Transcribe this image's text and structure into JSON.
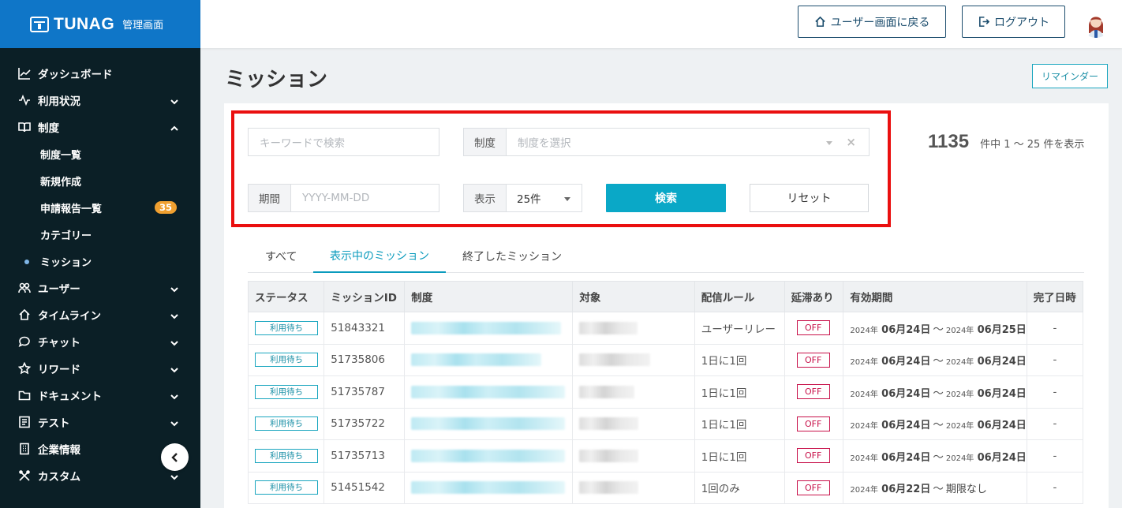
{
  "brand": {
    "name": "TUNAG",
    "subtitle": "管理画面"
  },
  "sidebar": {
    "items": [
      {
        "label": "ダッシュボード",
        "icon": "chart-line-icon"
      },
      {
        "label": "利用状況",
        "icon": "activity-icon"
      },
      {
        "label": "制度",
        "icon": "book-icon"
      },
      {
        "label": "ユーザー",
        "icon": "users-icon"
      },
      {
        "label": "タイムライン",
        "icon": "home-icon"
      },
      {
        "label": "チャット",
        "icon": "chat-icon"
      },
      {
        "label": "リワード",
        "icon": "star-icon"
      },
      {
        "label": "ドキュメント",
        "icon": "folder-icon"
      },
      {
        "label": "テスト",
        "icon": "checklist-icon"
      },
      {
        "label": "企業情報",
        "icon": "building-icon"
      },
      {
        "label": "カスタム",
        "icon": "tools-icon"
      }
    ],
    "sub_items": [
      {
        "label": "制度一覧"
      },
      {
        "label": "新規作成"
      },
      {
        "label": "申請報告一覧",
        "badge": "35"
      },
      {
        "label": "カテゴリー"
      },
      {
        "label": "ミッション"
      }
    ]
  },
  "header": {
    "back_label": "ユーザー画面に戻る",
    "logout_label": "ログアウト"
  },
  "page": {
    "title": "ミッション",
    "reminder_label": "リマインダー"
  },
  "filters": {
    "keyword_placeholder": "キーワードで検索",
    "system_label": "制度",
    "system_placeholder": "制度を選択",
    "period_label": "期間",
    "period_placeholder": "YYYY-MM-DD",
    "display_label": "表示",
    "display_value": "25件",
    "search_label": "検索",
    "reset_label": "リセット"
  },
  "results": {
    "total": "1135",
    "text": "件中 1 〜 25 件を表示"
  },
  "tabs": [
    {
      "label": "すべて"
    },
    {
      "label": "表示中のミッション"
    },
    {
      "label": "終了したミッション"
    }
  ],
  "table": {
    "columns": [
      "ステータス",
      "ミッションID",
      "制度",
      "対象",
      "配信ルール",
      "延滞あり",
      "有効期間",
      "完了日時"
    ],
    "rows": [
      {
        "status": "利用待ち",
        "id": "51843321",
        "rule": "ユーザーリレー",
        "overdue": "OFF",
        "start_year": "2024年",
        "start_date": "06月24日",
        "sep": "〜",
        "end_year": "2024年",
        "end_date": "06月25日",
        "done": "-"
      },
      {
        "status": "利用待ち",
        "id": "51735806",
        "rule": "1日に1回",
        "overdue": "OFF",
        "start_year": "2024年",
        "start_date": "06月24日",
        "sep": "〜",
        "end_year": "2024年",
        "end_date": "06月24日",
        "done": "-"
      },
      {
        "status": "利用待ち",
        "id": "51735787",
        "rule": "1日に1回",
        "overdue": "OFF",
        "start_year": "2024年",
        "start_date": "06月24日",
        "sep": "〜",
        "end_year": "2024年",
        "end_date": "06月24日",
        "done": "-"
      },
      {
        "status": "利用待ち",
        "id": "51735722",
        "rule": "1日に1回",
        "overdue": "OFF",
        "start_year": "2024年",
        "start_date": "06月24日",
        "sep": "〜",
        "end_year": "2024年",
        "end_date": "06月24日",
        "done": "-"
      },
      {
        "status": "利用待ち",
        "id": "51735713",
        "rule": "1日に1回",
        "overdue": "OFF",
        "start_year": "2024年",
        "start_date": "06月24日",
        "sep": "〜",
        "end_year": "2024年",
        "end_date": "06月24日",
        "done": "-"
      },
      {
        "status": "利用待ち",
        "id": "51451542",
        "rule": "1回のみ",
        "overdue": "OFF",
        "start_year": "2024年",
        "start_date": "06月22日",
        "sep": "〜",
        "end_year": "",
        "end_date": "期限なし",
        "done": "-"
      }
    ]
  },
  "colors": {
    "brand_blue": "#0f76c8",
    "sidebar_bg": "#0b1f26",
    "accent": "#0aa8c7",
    "highlight": "#ea0f0f",
    "off": "#c8114a"
  }
}
